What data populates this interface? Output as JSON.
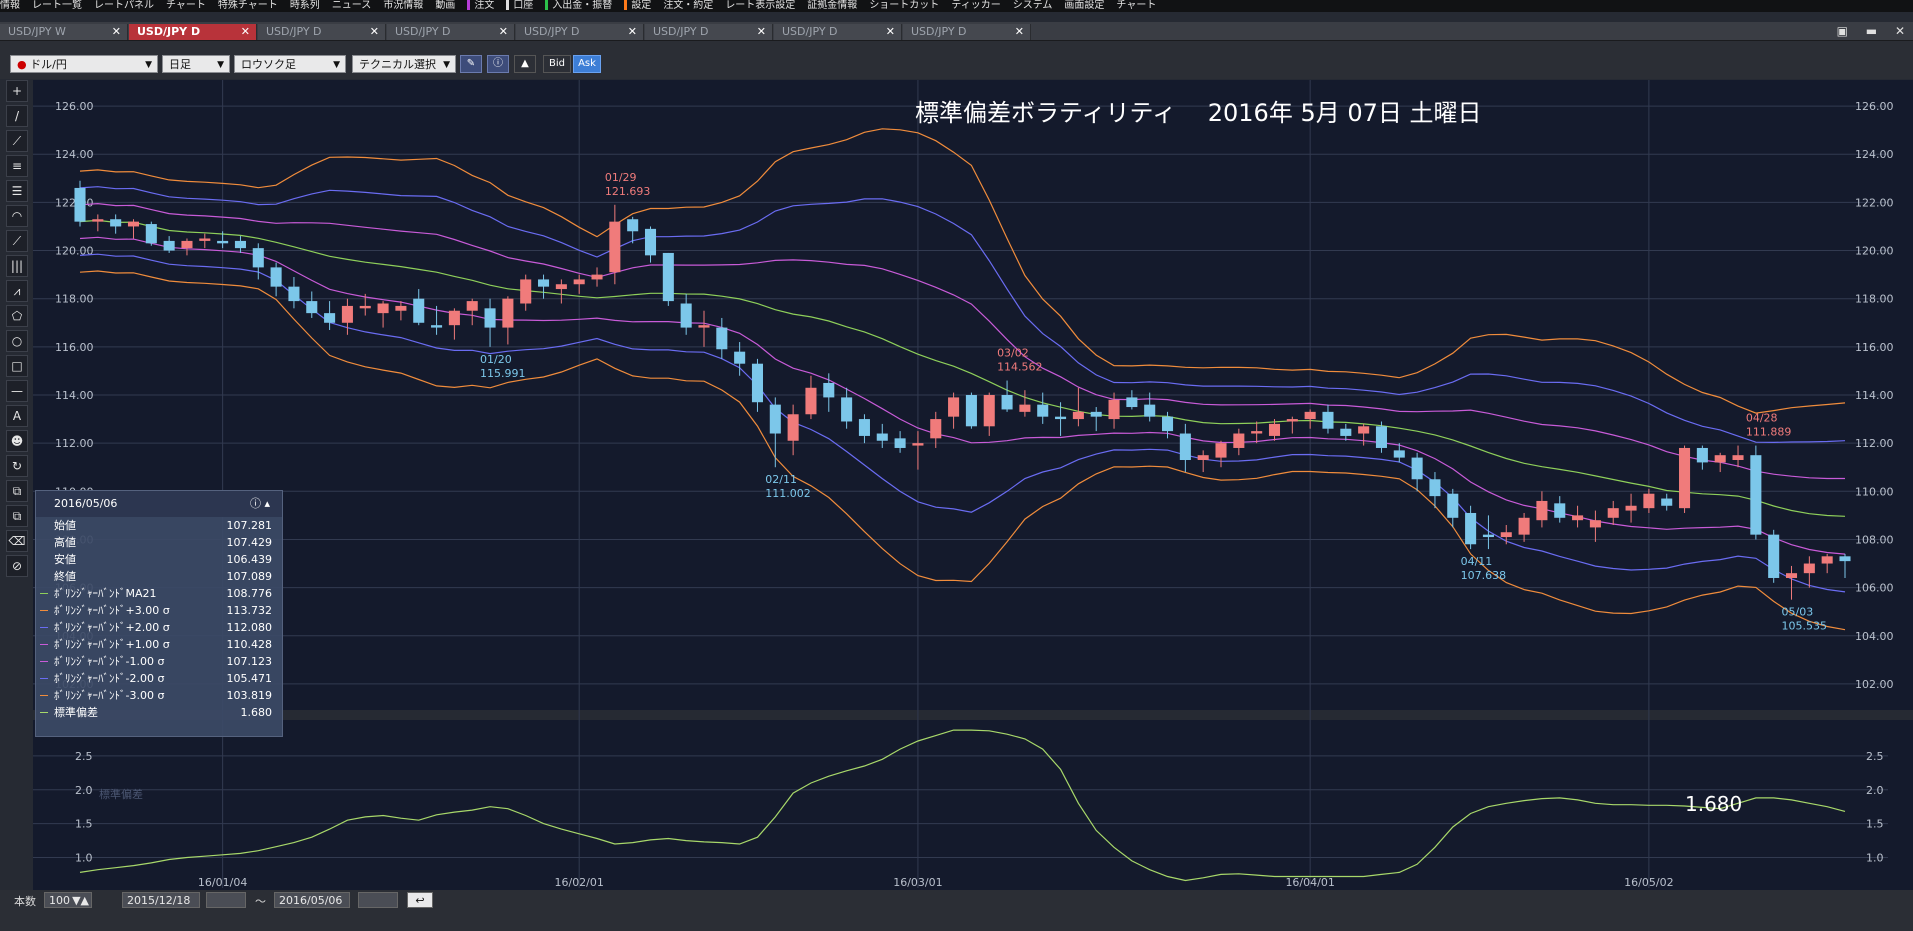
{
  "menu": [
    "情報",
    "レート一覧",
    "レートパネル",
    "チャート",
    "特殊チャート",
    "時系列",
    "ニュース",
    "市況情報",
    "動画",
    "注文",
    "口座",
    "入出金・振替",
    "設定",
    "注文・約定",
    "レート表示設定",
    "証拠金情報",
    "ショートカット",
    "ティッカー",
    "システム",
    "画面設定",
    "チャート"
  ],
  "tabs": [
    {
      "label": "USD/JPY W",
      "active": false
    },
    {
      "label": "USD/JPY D",
      "active": true
    },
    {
      "label": "USD/JPY D",
      "active": false
    },
    {
      "label": "USD/JPY D",
      "active": false
    },
    {
      "label": "USD/JPY D",
      "active": false
    },
    {
      "label": "USD/JPY D",
      "active": false
    },
    {
      "label": "USD/JPY D",
      "active": false
    },
    {
      "label": "USD/JPY D",
      "active": false
    }
  ],
  "toolbar": {
    "symbol": "ドル/円",
    "period": "日足",
    "chart_type": "ロウソク足",
    "technical": "テクニカル選択",
    "bid": "Bid",
    "ask": "Ask"
  },
  "chart": {
    "title": "標準偏差ボラティリティ　 2016年 5月 07日 土曜日",
    "price_ticks": [
      "126.00",
      "124.00",
      "122.00",
      "120.00",
      "118.00",
      "116.00",
      "114.00",
      "112.00",
      "110.00",
      "108.00",
      "106.00",
      "104.00",
      "102.00"
    ],
    "sub_ticks": [
      "2.5",
      "2.0",
      "1.5",
      "1.0"
    ],
    "x_ticks": [
      "16/01/04",
      "16/02/01",
      "16/03/01",
      "16/04/01",
      "16/05/02"
    ],
    "sub_value": "1.680",
    "sub_label": "標準偏差",
    "annotations": [
      {
        "date": "01/29",
        "value": "121.693",
        "kind": "high"
      },
      {
        "date": "01/20",
        "value": "115.991",
        "kind": "low"
      },
      {
        "date": "03/02",
        "value": "114.562",
        "kind": "high"
      },
      {
        "date": "02/11",
        "value": "111.002",
        "kind": "low"
      },
      {
        "date": "04/28",
        "value": "111.889",
        "kind": "high"
      },
      {
        "date": "04/11",
        "value": "107.638",
        "kind": "low"
      },
      {
        "date": "05/03",
        "value": "105.535",
        "kind": "low"
      }
    ],
    "colors": {
      "bg": "#1a2033",
      "up": "#f07b7b",
      "down": "#7cc7ea",
      "ma": "#8ecf5a",
      "b1": "#c85bd8",
      "b2": "#6a6cf2",
      "b3": "#f08c3c",
      "grid": "#323a50",
      "sd": "#a8d86a"
    }
  },
  "datapanel": {
    "date": "2016/05/06",
    "rows": [
      {
        "label": "始値",
        "value": "107.281",
        "color": ""
      },
      {
        "label": "高値",
        "value": "107.429",
        "color": ""
      },
      {
        "label": "安値",
        "value": "106.439",
        "color": ""
      },
      {
        "label": "終値",
        "value": "107.089",
        "color": ""
      },
      {
        "label": "ﾎﾞﾘﾝｼﾞｬｰﾊﾞﾝﾄﾞMA21",
        "value": "108.776",
        "color": "#8ecf5a"
      },
      {
        "label": "ﾎﾞﾘﾝｼﾞｬｰﾊﾞﾝﾄﾞ+3.00 σ",
        "value": "113.732",
        "color": "#f08c3c"
      },
      {
        "label": "ﾎﾞﾘﾝｼﾞｬｰﾊﾞﾝﾄﾞ+2.00 σ",
        "value": "112.080",
        "color": "#6a6cf2"
      },
      {
        "label": "ﾎﾞﾘﾝｼﾞｬｰﾊﾞﾝﾄﾞ+1.00 σ",
        "value": "110.428",
        "color": "#c85bd8"
      },
      {
        "label": "ﾎﾞﾘﾝｼﾞｬｰﾊﾞﾝﾄﾞ-1.00 σ",
        "value": "107.123",
        "color": "#c85bd8"
      },
      {
        "label": "ﾎﾞﾘﾝｼﾞｬｰﾊﾞﾝﾄﾞ-2.00 σ",
        "value": "105.471",
        "color": "#6a6cf2"
      },
      {
        "label": "ﾎﾞﾘﾝｼﾞｬｰﾊﾞﾝﾄﾞ-3.00 σ",
        "value": "103.819",
        "color": "#f08c3c"
      },
      {
        "label": "標準偏差",
        "value": "1.680",
        "color": "#a8d86a"
      }
    ]
  },
  "bottom": {
    "count_label": "本数",
    "count_value": "100",
    "from": "2015/12/18",
    "tilde": "～",
    "to": "2016/05/06"
  },
  "candles": [
    [
      122.6,
      122.9,
      121.0,
      121.2
    ],
    [
      121.2,
      121.5,
      120.8,
      121.3
    ],
    [
      121.3,
      121.5,
      120.7,
      121.0
    ],
    [
      121.0,
      121.3,
      120.5,
      121.2
    ],
    [
      121.1,
      121.2,
      120.2,
      120.3
    ],
    [
      120.4,
      120.6,
      119.9,
      120.0
    ],
    [
      120.1,
      120.5,
      119.8,
      120.4
    ],
    [
      120.4,
      120.7,
      120.1,
      120.5
    ],
    [
      120.4,
      120.8,
      120.1,
      120.3
    ],
    [
      120.4,
      120.6,
      119.9,
      120.1
    ],
    [
      120.1,
      120.3,
      118.8,
      119.3
    ],
    [
      119.3,
      119.5,
      118.1,
      118.5
    ],
    [
      118.5,
      118.9,
      117.6,
      117.9
    ],
    [
      117.9,
      118.3,
      117.2,
      117.4
    ],
    [
      117.4,
      117.9,
      116.7,
      117.0
    ],
    [
      117.0,
      118.0,
      116.5,
      117.7
    ],
    [
      117.6,
      118.2,
      117.3,
      117.7
    ],
    [
      117.4,
      117.9,
      116.8,
      117.8
    ],
    [
      117.5,
      117.9,
      117.1,
      117.7
    ],
    [
      118.0,
      118.4,
      116.9,
      117.0
    ],
    [
      116.9,
      117.7,
      116.5,
      116.8
    ],
    [
      116.9,
      117.6,
      116.3,
      117.5
    ],
    [
      117.5,
      118.0,
      116.9,
      117.9
    ],
    [
      117.6,
      118.0,
      116.0,
      116.8
    ],
    [
      116.8,
      118.1,
      116.1,
      118.0
    ],
    [
      117.8,
      119.0,
      117.5,
      118.8
    ],
    [
      118.8,
      119.0,
      118.0,
      118.5
    ],
    [
      118.4,
      118.8,
      117.8,
      118.6
    ],
    [
      118.6,
      119.0,
      118.2,
      118.8
    ],
    [
      118.8,
      119.3,
      118.5,
      119.0
    ],
    [
      119.1,
      121.9,
      118.6,
      121.2
    ],
    [
      121.3,
      121.4,
      120.3,
      120.8
    ],
    [
      120.9,
      121.0,
      119.5,
      119.8
    ],
    [
      119.9,
      119.9,
      117.7,
      117.9
    ],
    [
      117.8,
      118.2,
      116.5,
      116.8
    ],
    [
      116.8,
      117.5,
      116.0,
      116.9
    ],
    [
      116.8,
      117.2,
      115.5,
      115.9
    ],
    [
      115.8,
      116.2,
      114.8,
      115.3
    ],
    [
      115.3,
      115.5,
      113.3,
      113.7
    ],
    [
      113.6,
      113.9,
      111.0,
      112.4
    ],
    [
      112.1,
      113.6,
      111.5,
      113.2
    ],
    [
      113.2,
      114.8,
      113.0,
      114.3
    ],
    [
      114.5,
      114.9,
      113.3,
      113.9
    ],
    [
      113.9,
      114.3,
      112.6,
      112.9
    ],
    [
      113.0,
      113.2,
      112.0,
      112.3
    ],
    [
      112.4,
      112.8,
      111.8,
      112.1
    ],
    [
      112.2,
      112.5,
      111.6,
      111.8
    ],
    [
      111.9,
      112.5,
      110.9,
      112.0
    ],
    [
      112.2,
      113.3,
      111.8,
      113.0
    ],
    [
      113.1,
      114.1,
      112.6,
      113.9
    ],
    [
      114.0,
      114.1,
      112.6,
      112.7
    ],
    [
      112.7,
      114.1,
      112.3,
      114.0
    ],
    [
      114.0,
      114.6,
      113.3,
      113.4
    ],
    [
      113.3,
      114.2,
      113.1,
      113.6
    ],
    [
      113.6,
      114.1,
      112.8,
      113.1
    ],
    [
      113.1,
      113.7,
      112.3,
      113.0
    ],
    [
      113.0,
      114.3,
      112.7,
      113.3
    ],
    [
      113.3,
      113.5,
      112.5,
      113.1
    ],
    [
      113.0,
      114.1,
      112.6,
      113.8
    ],
    [
      113.9,
      114.2,
      113.4,
      113.5
    ],
    [
      113.6,
      114.1,
      112.9,
      113.1
    ],
    [
      113.1,
      113.3,
      112.2,
      112.5
    ],
    [
      112.4,
      112.8,
      110.8,
      111.3
    ],
    [
      111.3,
      111.7,
      110.8,
      111.5
    ],
    [
      111.4,
      112.1,
      111.0,
      112.0
    ],
    [
      111.8,
      112.6,
      111.5,
      112.4
    ],
    [
      112.4,
      112.9,
      112.0,
      112.5
    ],
    [
      112.3,
      113.0,
      112.1,
      112.8
    ],
    [
      112.9,
      113.1,
      112.4,
      113.0
    ],
    [
      113.0,
      113.4,
      112.6,
      113.3
    ],
    [
      113.3,
      113.6,
      112.4,
      112.6
    ],
    [
      112.6,
      112.8,
      112.1,
      112.3
    ],
    [
      112.4,
      112.8,
      111.9,
      112.7
    ],
    [
      112.7,
      112.9,
      111.6,
      111.8
    ],
    [
      111.7,
      112.0,
      111.2,
      111.4
    ],
    [
      111.4,
      111.6,
      110.0,
      110.5
    ],
    [
      110.5,
      110.8,
      109.3,
      109.8
    ],
    [
      109.9,
      110.1,
      108.5,
      108.9
    ],
    [
      109.1,
      109.4,
      107.6,
      107.8
    ],
    [
      108.2,
      109.0,
      107.6,
      108.1
    ],
    [
      108.1,
      108.6,
      107.8,
      108.3
    ],
    [
      108.2,
      109.1,
      107.9,
      108.9
    ],
    [
      108.8,
      110.0,
      108.5,
      109.6
    ],
    [
      109.5,
      109.8,
      108.7,
      108.9
    ],
    [
      108.8,
      109.4,
      108.5,
      109.0
    ],
    [
      108.5,
      109.2,
      107.9,
      108.8
    ],
    [
      108.9,
      109.6,
      108.6,
      109.3
    ],
    [
      109.2,
      109.9,
      108.7,
      109.4
    ],
    [
      109.3,
      110.1,
      109.1,
      109.9
    ],
    [
      109.7,
      109.9,
      109.2,
      109.4
    ],
    [
      109.3,
      111.9,
      109.1,
      111.8
    ],
    [
      111.8,
      111.9,
      110.9,
      111.2
    ],
    [
      111.2,
      111.6,
      110.8,
      111.5
    ],
    [
      111.3,
      111.9,
      111.0,
      111.5
    ],
    [
      111.5,
      111.9,
      108.0,
      108.2
    ],
    [
      108.2,
      108.4,
      106.2,
      106.4
    ],
    [
      106.4,
      106.9,
      105.5,
      106.6
    ],
    [
      106.6,
      107.3,
      106.0,
      107.0
    ],
    [
      107.0,
      107.4,
      106.6,
      107.3
    ],
    [
      107.3,
      107.4,
      106.4,
      107.1
    ]
  ],
  "sd_series": [
    0.78,
    0.82,
    0.85,
    0.88,
    0.92,
    0.97,
    1.0,
    1.02,
    1.04,
    1.06,
    1.1,
    1.16,
    1.22,
    1.3,
    1.42,
    1.55,
    1.6,
    1.62,
    1.58,
    1.55,
    1.63,
    1.67,
    1.7,
    1.75,
    1.72,
    1.62,
    1.5,
    1.42,
    1.35,
    1.28,
    1.2,
    1.22,
    1.26,
    1.28,
    1.25,
    1.23,
    1.22,
    1.2,
    1.3,
    1.6,
    1.95,
    2.1,
    2.2,
    2.28,
    2.35,
    2.45,
    2.6,
    2.72,
    2.8,
    2.88,
    2.88,
    2.87,
    2.82,
    2.75,
    2.6,
    2.3,
    1.8,
    1.4,
    1.15,
    0.95,
    0.82,
    0.72,
    0.66,
    0.7,
    0.75,
    0.76,
    0.74,
    0.72,
    0.72,
    0.72,
    0.72,
    0.72,
    0.72,
    0.75,
    0.78,
    0.9,
    1.15,
    1.45,
    1.65,
    1.75,
    1.8,
    1.84,
    1.87,
    1.88,
    1.85,
    1.8,
    1.78,
    1.78,
    1.77,
    1.77,
    1.76,
    1.74,
    1.72,
    1.8,
    1.88,
    1.88,
    1.85,
    1.8,
    1.75,
    1.68
  ]
}
